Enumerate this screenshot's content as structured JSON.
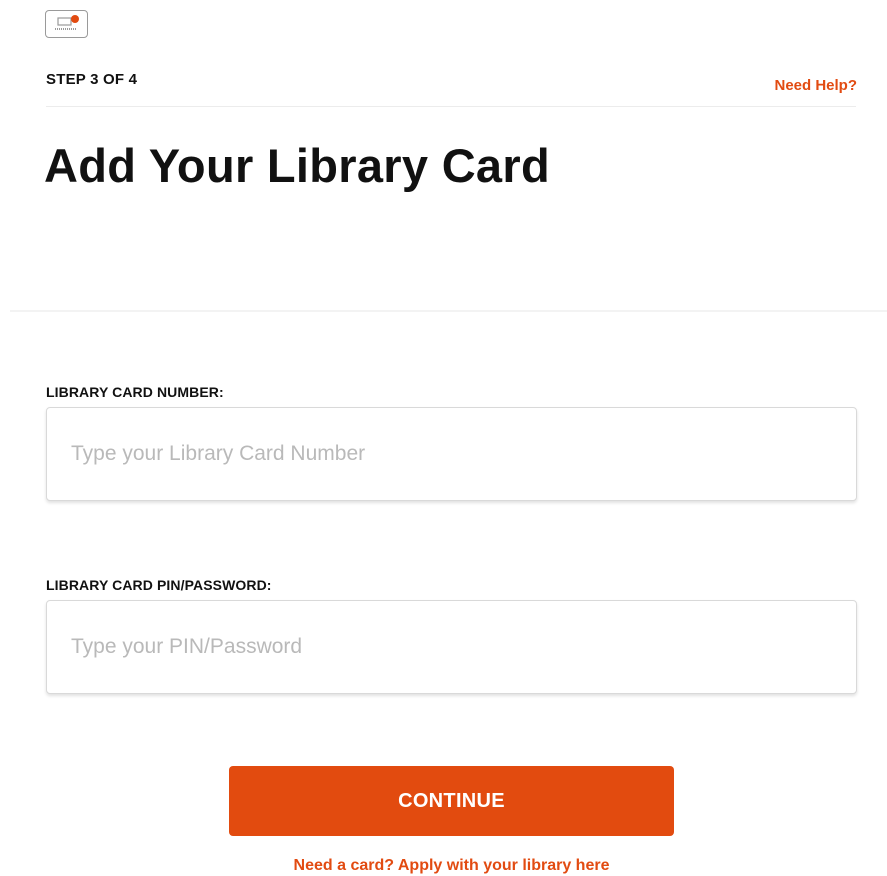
{
  "header": {
    "icon": "library-card-icon",
    "step_label": "STEP 3 OF 4",
    "help_link": "Need Help?"
  },
  "main": {
    "title": "Add Your Library Card",
    "card_number_field": {
      "label": "LIBRARY CARD NUMBER:",
      "value": "",
      "placeholder": "Type your Library Card Number"
    },
    "pin_field": {
      "label": "LIBRARY CARD PIN/PASSWORD:",
      "value": "",
      "placeholder": "Type your PIN/Password"
    },
    "continue_label": "CONTINUE",
    "apply_link": "Need a card? Apply with your library here"
  },
  "colors": {
    "accent": "#e24b0f",
    "text": "#111111",
    "placeholder": "#b9b9b9"
  }
}
